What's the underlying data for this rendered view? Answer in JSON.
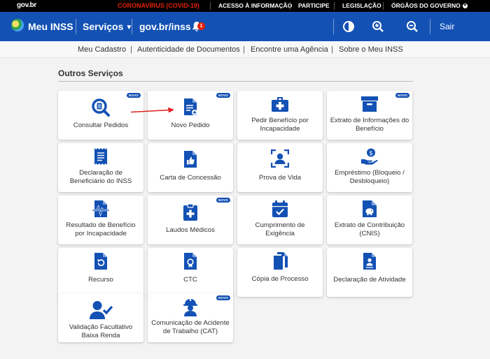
{
  "govbar": {
    "logo": "gov.br",
    "covid": "CORONAVÍRUS (COVID-19)",
    "links": [
      "ACESSO À INFORMAÇÃO",
      "PARTICIPE",
      "LEGISLAÇÃO",
      "ÓRGÃOS DO GOVERNO"
    ]
  },
  "header": {
    "title": "Meu INSS",
    "menu": "Serviços",
    "govinss": "gov.br/inss",
    "notification_count": "1",
    "logout": "Sair"
  },
  "subnav": [
    "Meu Cadastro",
    "Autenticidade de Documentos",
    "Encontre uma Agência",
    "Sobre o Meu INSS"
  ],
  "section": {
    "title": "Outros Serviços"
  },
  "novo_label": "NOVO",
  "cards": [
    {
      "label": "Consultar Pedidos",
      "icon": "search-document-icon",
      "novo": true
    },
    {
      "label": "Novo Pedido",
      "icon": "new-document-icon",
      "novo": true
    },
    {
      "label": "Pedir Benefício por Incapacidade",
      "icon": "medical-kit-icon",
      "novo": false
    },
    {
      "label": "Extrato de Informações do Benefício",
      "icon": "archive-box-icon",
      "novo": true
    },
    {
      "label": "Declaração de Beneficiário do INSS",
      "icon": "receipt-icon",
      "novo": false
    },
    {
      "label": "Carta de Concessão",
      "icon": "thumbs-up-document-icon",
      "novo": false
    },
    {
      "label": "Prova de Vida",
      "icon": "face-scan-icon",
      "novo": false
    },
    {
      "label": "Empréstimo (Bloqueio / Desbloqueio)",
      "icon": "money-hand-icon",
      "novo": false
    },
    {
      "label": "Resultado de Benefício por Incapacidade",
      "icon": "heartbeat-document-icon",
      "novo": false
    },
    {
      "label": "Laudos Médicos",
      "icon": "medical-clipboard-icon",
      "novo": true
    },
    {
      "label": "Cumprimento de Exigência",
      "icon": "calendar-check-icon",
      "novo": false
    },
    {
      "label": "Extrato de Contribuição (CNIS)",
      "icon": "piggy-document-icon",
      "novo": false
    },
    {
      "label": "Recurso",
      "icon": "undo-document-icon",
      "novo": false
    },
    {
      "label": "CTC",
      "icon": "certificate-icon",
      "novo": false
    },
    {
      "label": "Cópia de Processo",
      "icon": "copy-icon",
      "novo": false
    },
    {
      "label": "Declaração de Atividade",
      "icon": "person-document-icon",
      "novo": false
    },
    {
      "label": "Validação Facultativo Baixa Renda",
      "icon": "user-check-icon",
      "novo": false
    },
    {
      "label": "Comunicação de Acidente de Trabalho (CAT)",
      "icon": "worker-icon",
      "novo": true
    }
  ],
  "colors": {
    "brand_blue": "#1351b4",
    "covid_red": "#e52207",
    "arrow_red": "#e02020"
  }
}
